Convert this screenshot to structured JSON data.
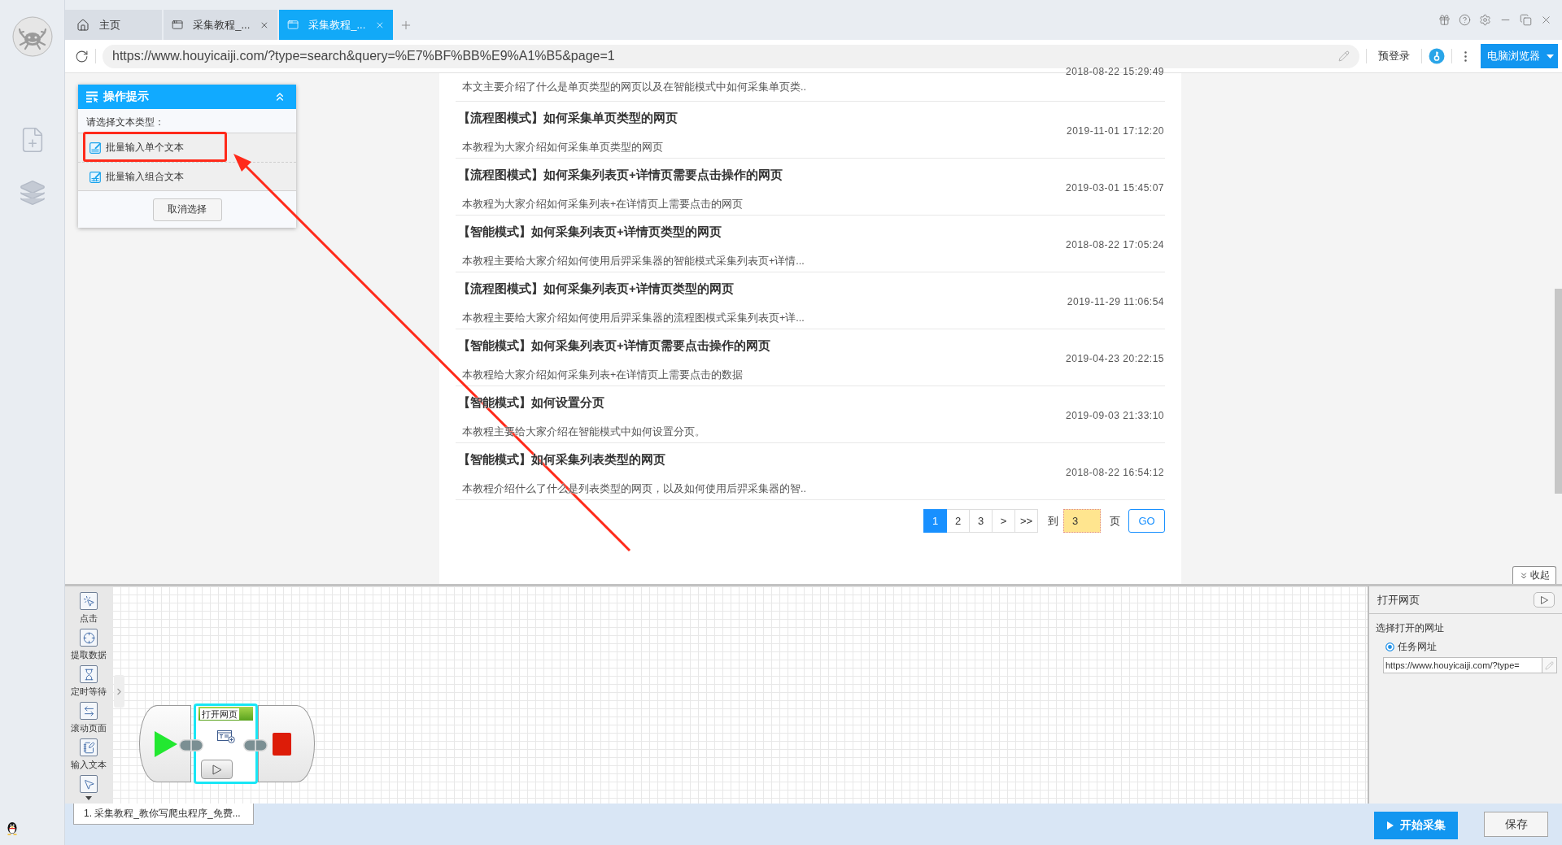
{
  "tabs": [
    {
      "kind": "home",
      "label": "主页",
      "selected": false,
      "closable": false
    },
    {
      "kind": "page",
      "label": "采集教程_...",
      "selected": false,
      "closable": true
    },
    {
      "kind": "page",
      "label": "采集教程_...",
      "selected": true,
      "closable": true
    }
  ],
  "address_bar": {
    "url": "https://www.houyicaiji.com/?type=search&query=%E7%BF%BB%E9%A1%B5&page=1",
    "login": "预登录",
    "mode": "电脑浏览器"
  },
  "tips": {
    "title": "操作提示",
    "prompt": "请选择文本类型：",
    "options": [
      {
        "kind": "single",
        "label": "批量输入单个文本",
        "annotated": true
      },
      {
        "kind": "combined",
        "label": "批量输入组合文本",
        "annotated": false
      }
    ],
    "cancel": "取消选择"
  },
  "articles": [
    {
      "summary": "本文主要介绍了什么是单页类型的网页以及在智能模式中如何采集单页类..",
      "date": "2018-08-22 15:29:49"
    },
    {
      "title": "【流程图模式】如何采集单页类型的网页",
      "summary": "本教程为大家介绍如何采集单页类型的网页",
      "date": "2019-11-01 17:12:20"
    },
    {
      "title": "【流程图模式】如何采集列表页+详情页需要点击操作的网页",
      "summary": "本教程为大家介绍如何采集列表+在详情页上需要点击的网页",
      "date": "2019-03-01 15:45:07"
    },
    {
      "title": "【智能模式】如何采集列表页+详情页类型的网页",
      "summary": "本教程主要给大家介绍如何使用后羿采集器的智能模式采集列表页+详情...",
      "date": "2018-08-22 17:05:24"
    },
    {
      "title": "【流程图模式】如何采集列表页+详情页类型的网页",
      "summary": "本教程主要给大家介绍如何使用后羿采集器的流程图模式采集列表页+详...",
      "date": "2019-11-29 11:06:54"
    },
    {
      "title": "【智能模式】如何采集列表页+详情页需要点击操作的网页",
      "summary": "本教程给大家介绍如何采集列表+在详情页上需要点击的数据",
      "date": "2019-04-23 20:22:15"
    },
    {
      "title": "【智能模式】如何设置分页",
      "summary": "本教程主要给大家介绍在智能模式中如何设置分页。",
      "date": "2019-09-03 21:33:10"
    },
    {
      "title": "【智能模式】如何采集列表类型的网页",
      "summary": "本教程介绍什么了什么是列表类型的网页，以及如何使用后羿采集器的智..",
      "date": "2018-08-22 16:54:12"
    }
  ],
  "pagination": {
    "pages": [
      {
        "label": "1",
        "selected": true
      },
      {
        "label": "2",
        "selected": false
      },
      {
        "label": "3",
        "selected": false
      }
    ],
    "next": ">",
    "last": ">>",
    "goto_label": "到",
    "goto_value": "3",
    "page_unit": "页",
    "go": "GO"
  },
  "collapse": "收起",
  "toolbox": [
    {
      "kind": "click",
      "label": "点击"
    },
    {
      "kind": "extract",
      "label": "提取数据"
    },
    {
      "kind": "wait",
      "label": "定时等待"
    },
    {
      "kind": "scroll",
      "label": "滚动页面"
    },
    {
      "kind": "input",
      "label": "输入文本"
    },
    {
      "kind": "hover"
    }
  ],
  "flow": {
    "steps": [
      {
        "kind": "start"
      },
      {
        "kind": "open-page",
        "label": "打开网页",
        "selected": true
      },
      {
        "kind": "end"
      }
    ]
  },
  "properties": {
    "title": "打开网页",
    "section": "选择打开的网址",
    "sources": [
      {
        "label": "任务网址",
        "selected": true
      }
    ],
    "url": "https://www.houyicaiji.com/?type="
  },
  "task_tabs": [
    {
      "label": "1. 采集教程_教你写爬虫程序_免费...",
      "selected": true
    }
  ],
  "actions": {
    "start": "开始采集",
    "save": "保存"
  }
}
